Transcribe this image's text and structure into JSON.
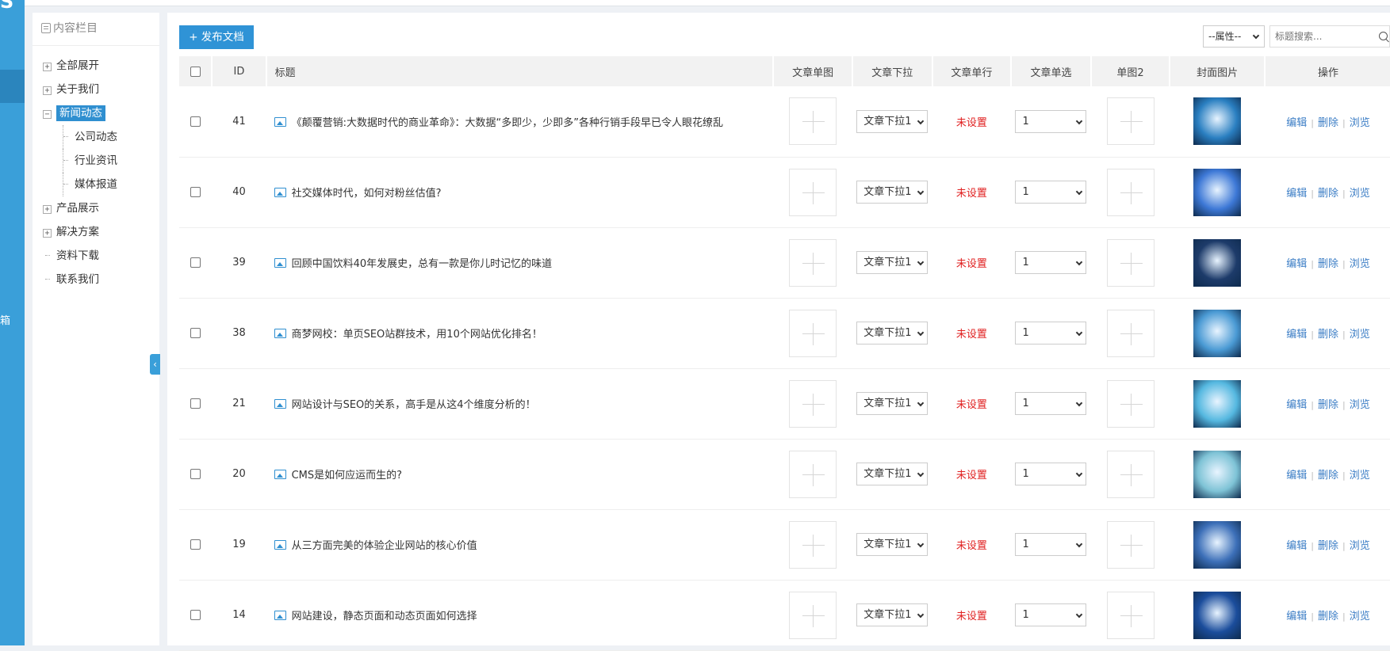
{
  "leftbar": {
    "brand": "S",
    "vert_text": "箱"
  },
  "tree": {
    "title": "内容栏目",
    "items": [
      {
        "label": "全部展开",
        "toggle": "+"
      },
      {
        "label": "关于我们",
        "toggle": "+"
      },
      {
        "label": "新闻动态",
        "toggle": "−",
        "selected": true
      },
      {
        "label": "公司动态"
      },
      {
        "label": "行业资讯"
      },
      {
        "label": "媒体报道"
      },
      {
        "label": "产品展示",
        "toggle": "+"
      },
      {
        "label": "解决方案",
        "toggle": "+"
      },
      {
        "label": "资料下载"
      },
      {
        "label": "联系我们"
      }
    ]
  },
  "toolbar": {
    "publish_label": "+ 发布文档",
    "attr_select": "--属性--",
    "search_placeholder": "标题搜索..."
  },
  "table": {
    "headers": {
      "id": "ID",
      "title": "标题",
      "single_img": "文章单图",
      "dropdown": "文章下拉",
      "single_line": "文章单行",
      "radio": "文章单选",
      "img2": "单图2",
      "cover": "封面图片",
      "ops": "操作"
    },
    "dropdown_value": "文章下拉1",
    "single_line_value": "未设置",
    "radio_value": "1",
    "ops": {
      "edit": "编辑",
      "delete": "删除",
      "view": "浏览"
    },
    "rows": [
      {
        "id": "41",
        "title": "《颠覆营销:大数据时代的商业革命》：大数据“多即少，少即多”各种行销手段早已令人眼花缭乱",
        "cover_color": "#2a7fc1"
      },
      {
        "id": "40",
        "title": "社交媒体时代，如何对粉丝估值?",
        "cover_color": "#3d78d6"
      },
      {
        "id": "39",
        "title": "回顾中国饮料40年发展史，总有一款是你儿时记忆的味道",
        "cover_color": "#1d3b6a"
      },
      {
        "id": "38",
        "title": "商梦网校：单页SEO站群技术，用10个网站优化排名！",
        "cover_color": "#4a9ad4"
      },
      {
        "id": "21",
        "title": "网站设计与SEO的关系，高手是从这4个维度分析的！",
        "cover_color": "#55b8e0"
      },
      {
        "id": "20",
        "title": "CMS是如何应运而生的?",
        "cover_color": "#7ec3d6"
      },
      {
        "id": "19",
        "title": "从三方面完美的体验企业网站的核心价值",
        "cover_color": "#3c6fb8"
      },
      {
        "id": "14",
        "title": "网站建设，静态页面和动态页面如何选择",
        "cover_color": "#1b4d9c"
      }
    ]
  }
}
